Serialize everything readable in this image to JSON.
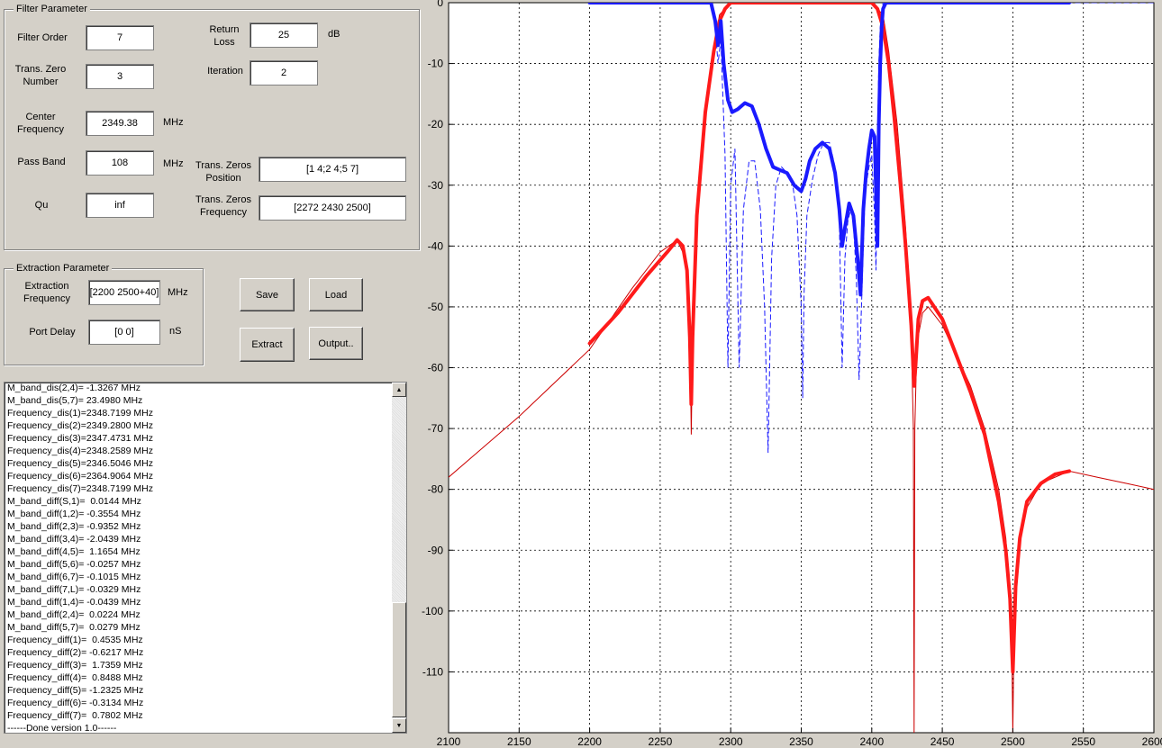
{
  "filter_group": {
    "title": "Filter Parameter",
    "filter_order_label": "Filter Order",
    "filter_order": "7",
    "return_loss_label": "Return\nLoss",
    "return_loss": "25",
    "return_loss_unit": "dB",
    "tz_number_label": "Trans. Zero\nNumber",
    "tz_number": "3",
    "iteration_label": "Iteration",
    "iteration": "2",
    "center_freq_label": "Center\nFrequency",
    "center_freq": "2349.38",
    "center_freq_unit": "MHz",
    "pass_band_label": "Pass Band",
    "pass_band": "108",
    "pass_band_unit": "MHz",
    "tz_position_label": "Trans. Zeros\nPosition",
    "tz_position": "[1 4;2 4;5 7]",
    "qu_label": "Qu",
    "qu": "inf",
    "tz_frequency_label": "Trans. Zeros\nFrequency",
    "tz_frequency": "[2272 2430 2500]"
  },
  "extraction_group": {
    "title": "Extraction Parameter",
    "extraction_freq_label": "Extraction\nFrequency",
    "extraction_freq": "[2200 2500+40]",
    "extraction_freq_unit": "MHz",
    "port_delay_label": "Port Delay",
    "port_delay": "[0 0]",
    "port_delay_unit": "nS"
  },
  "buttons": {
    "save": "Save",
    "load": "Load",
    "extract": "Extract",
    "output": "Output.."
  },
  "log_lines": [
    "M_band_dis(2,4)= -1.3267 MHz",
    "M_band_dis(5,7)= 23.4980 MHz",
    "Frequency_dis(1)=2348.7199 MHz",
    "Frequency_dis(2)=2349.2800 MHz",
    "Frequency_dis(3)=2347.4731 MHz",
    "Frequency_dis(4)=2348.2589 MHz",
    "Frequency_dis(5)=2346.5046 MHz",
    "Frequency_dis(6)=2364.9064 MHz",
    "Frequency_dis(7)=2348.7199 MHz",
    "M_band_diff(S,1)=  0.0144 MHz",
    "M_band_diff(1,2)= -0.3554 MHz",
    "M_band_diff(2,3)= -0.9352 MHz",
    "M_band_diff(3,4)= -2.0439 MHz",
    "M_band_diff(4,5)=  1.1654 MHz",
    "M_band_diff(5,6)= -0.0257 MHz",
    "M_band_diff(6,7)= -0.1015 MHz",
    "M_band_diff(7,L)= -0.0329 MHz",
    "M_band_diff(1,4)= -0.0439 MHz",
    "M_band_diff(2,4)=  0.0224 MHz",
    "M_band_diff(5,7)=  0.0279 MHz",
    "Frequency_diff(1)=  0.4535 MHz",
    "Frequency_diff(2)= -0.6217 MHz",
    "Frequency_diff(3)=  1.7359 MHz",
    "Frequency_diff(4)=  0.8488 MHz",
    "Frequency_diff(5)= -1.2325 MHz",
    "Frequency_diff(6)= -0.3134 MHz",
    "Frequency_diff(7)=  0.7802 MHz",
    "------Done version 1.0------"
  ],
  "colors": {
    "s11": "#1a1aff",
    "s21": "#ff1a1a",
    "grid": "#000000"
  },
  "chart_data": {
    "type": "line",
    "xlim": [
      2100,
      2600
    ],
    "ylim": [
      -120,
      0
    ],
    "xticks": [
      2100,
      2150,
      2200,
      2250,
      2300,
      2350,
      2400,
      2450,
      2500,
      2550,
      2600
    ],
    "yticks": [
      0,
      -10,
      -20,
      -30,
      -40,
      -50,
      -60,
      -70,
      -80,
      -90,
      -100,
      -110
    ],
    "grid": true,
    "series": [
      {
        "role": "s21_model",
        "style": "solid-thin",
        "color": "#cc0000",
        "x": [
          2100,
          2150,
          2200,
          2230,
          2250,
          2262,
          2268,
          2271,
          2272,
          2273,
          2276,
          2282,
          2288,
          2292,
          2300,
          2350,
          2400,
          2408,
          2412,
          2418,
          2424,
          2428,
          2429.5,
          2430,
          2430.5,
          2432,
          2436,
          2440,
          2450,
          2460,
          2470,
          2480,
          2490,
          2495,
          2498,
          2499.5,
          2500,
          2500.5,
          2502,
          2505,
          2510,
          2520,
          2540,
          2560,
          2580,
          2600
        ],
        "y": [
          -78,
          -68,
          -57,
          -47,
          -41,
          -39,
          -42,
          -52,
          -71,
          -55,
          -35,
          -18,
          -8,
          -2,
          0,
          0,
          0,
          -2,
          -8,
          -20,
          -37,
          -55,
          -70,
          -120,
          -70,
          -56,
          -51,
          -50,
          -53,
          -58,
          -63,
          -70,
          -80,
          -88,
          -97,
          -110,
          -120,
          -110,
          -96,
          -88,
          -83,
          -79,
          -77,
          -78,
          -79,
          -80
        ]
      },
      {
        "role": "s21_measured",
        "style": "thick-markers",
        "color": "#ff1a1a",
        "x": [
          2200,
          2220,
          2240,
          2255,
          2262,
          2266,
          2269,
          2271,
          2272,
          2273,
          2276,
          2282,
          2288,
          2292,
          2296,
          2300,
          2350,
          2400,
          2404,
          2408,
          2412,
          2416,
          2420,
          2424,
          2428,
          2430,
          2431,
          2433,
          2436,
          2440,
          2450,
          2460,
          2470,
          2480,
          2490,
          2495,
          2498,
          2500,
          2502,
          2505,
          2510,
          2520,
          2530,
          2540
        ],
        "y": [
          -56,
          -51,
          -45,
          -41,
          -39,
          -40,
          -44,
          -55,
          -66,
          -55,
          -35,
          -18,
          -8,
          -3,
          -1,
          0,
          0,
          0,
          -1,
          -4,
          -10,
          -19,
          -29,
          -40,
          -53,
          -63,
          -60,
          -52,
          -49,
          -48.5,
          -52,
          -58,
          -64,
          -71,
          -82,
          -90,
          -98,
          -110,
          -96,
          -88,
          -82,
          -79,
          -77.5,
          -77
        ]
      },
      {
        "role": "s11_model",
        "style": "dash-thin",
        "color": "#1a1aff",
        "x": [
          2200,
          2286,
          2289,
          2291,
          2293,
          2296,
          2298,
          2300,
          2303,
          2306,
          2309,
          2313,
          2317,
          2321,
          2324,
          2326.5,
          2329,
          2332,
          2336,
          2340,
          2344,
          2347,
          2350,
          2351,
          2352,
          2354,
          2358,
          2362,
          2366,
          2370,
          2374,
          2377,
          2379,
          2381,
          2383,
          2385,
          2387,
          2389,
          2391,
          2393,
          2394,
          2395,
          2396,
          2398,
          2400,
          2402,
          2403,
          2404,
          2405,
          2406,
          2408,
          2410,
          2600
        ],
        "y": [
          0,
          0,
          -4,
          -10,
          -6,
          -25,
          -60,
          -30,
          -24,
          -60,
          -34,
          -26,
          -26,
          -34,
          -50,
          -74,
          -42,
          -30,
          -27,
          -28,
          -30,
          -35,
          -50,
          -65,
          -48,
          -35,
          -29,
          -25,
          -23,
          -23,
          -27,
          -36,
          -60,
          -42,
          -36,
          -34,
          -36,
          -45,
          -62,
          -48,
          -40,
          -33,
          -30,
          -27,
          -25,
          -35,
          -44,
          -24,
          -10,
          -4,
          0,
          0,
          0
        ]
      },
      {
        "role": "s11_measured",
        "style": "thick-markers",
        "color": "#1a1aff",
        "x": [
          2200,
          2286,
          2289,
          2291,
          2293,
          2295,
          2298,
          2301,
          2305,
          2310,
          2315,
          2320,
          2325,
          2330,
          2335,
          2340,
          2345,
          2350,
          2353,
          2356,
          2360,
          2365,
          2370,
          2374,
          2377,
          2379,
          2381,
          2384,
          2387,
          2390,
          2392,
          2394,
          2396,
          2398,
          2400,
          2402,
          2404,
          2405,
          2406,
          2407,
          2408,
          2410,
          2540
        ],
        "y": [
          0,
          0,
          -3,
          -7,
          -3,
          -10,
          -16,
          -18,
          -17.5,
          -16.5,
          -17,
          -20,
          -24,
          -27,
          -27.5,
          -28,
          -30,
          -31,
          -29,
          -26,
          -24,
          -23,
          -24,
          -28,
          -34,
          -40,
          -37,
          -33,
          -35,
          -42,
          -48,
          -34,
          -28,
          -24,
          -21,
          -22,
          -40,
          -20,
          -10,
          -4,
          -1,
          0,
          0
        ]
      }
    ]
  }
}
